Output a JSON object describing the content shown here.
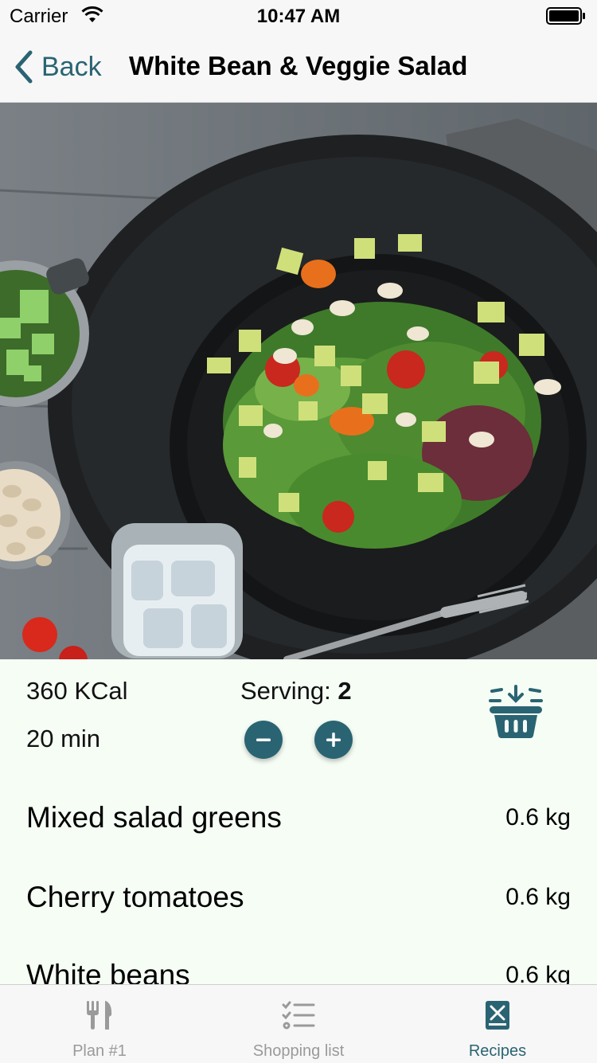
{
  "status_bar": {
    "carrier": "Carrier",
    "time": "10:47 AM"
  },
  "nav": {
    "back_label": "Back",
    "title": "White Bean & Veggie Salad"
  },
  "recipe": {
    "calories": "360 KCal",
    "duration": "20 min",
    "serving_label": "Serving:",
    "serving_count": "2"
  },
  "ingredients": [
    {
      "name": "Mixed salad greens",
      "quantity": "0.6 kg"
    },
    {
      "name": "Cherry tomatoes",
      "quantity": "0.6 kg"
    },
    {
      "name": "White beans",
      "quantity": "0.6 kg"
    }
  ],
  "tabs": [
    {
      "label": "Plan #1",
      "icon": "fork-knife-icon",
      "active": false
    },
    {
      "label": "Shopping list",
      "icon": "checklist-icon",
      "active": false
    },
    {
      "label": "Recipes",
      "icon": "recipe-book-icon",
      "active": true
    }
  ],
  "colors": {
    "accent": "#2a6473",
    "background": "#f5fdf5",
    "inactive": "#9a9a9a"
  }
}
